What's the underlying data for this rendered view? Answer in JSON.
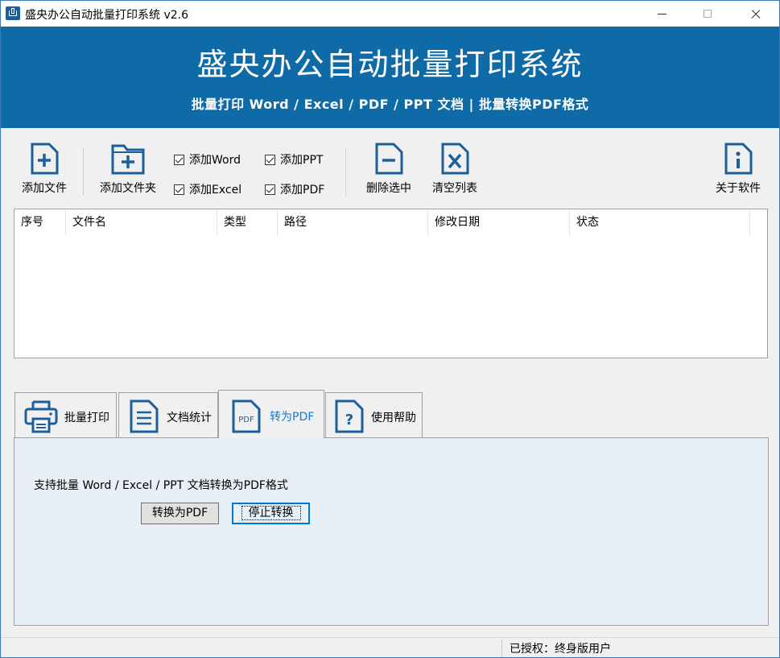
{
  "window": {
    "title": "盛央办公自动批量打印系统 v2.6"
  },
  "banner": {
    "title": "盛央办公自动批量打印系统",
    "subtitle": "批量打印 Word / Excel / PDF / PPT 文档  |  批量转换PDF格式"
  },
  "toolbar": {
    "add_file": "添加文件",
    "add_folder": "添加文件夹",
    "delete_selected": "删除选中",
    "clear_list": "清空列表",
    "about": "关于软件",
    "filters": [
      {
        "label": "添加Word",
        "checked": true
      },
      {
        "label": "添加PPT",
        "checked": true
      },
      {
        "label": "添加Excel",
        "checked": true
      },
      {
        "label": "添加PDF",
        "checked": true
      }
    ]
  },
  "file_list": {
    "columns": [
      "序号",
      "文件名",
      "类型",
      "路径",
      "修改日期",
      "状态"
    ],
    "rows": []
  },
  "tabs": [
    {
      "label": "批量打印",
      "icon": "printer-icon",
      "active": false
    },
    {
      "label": "文档统计",
      "icon": "document-lines-icon",
      "active": false
    },
    {
      "label": "转为PDF",
      "icon": "pdf-file-icon",
      "active": true
    },
    {
      "label": "使用帮助",
      "icon": "help-file-icon",
      "active": false
    }
  ],
  "pdf_panel": {
    "description": "支持批量 Word / Excel / PPT 文档转换为PDF格式",
    "convert_button": "转换为PDF",
    "stop_button": "停止转换"
  },
  "status": {
    "license": "已授权：终身版用户"
  },
  "colors": {
    "banner": "#0f6aa8",
    "icon": "#1d5f9a",
    "active_tab_text": "#1e78c8"
  }
}
